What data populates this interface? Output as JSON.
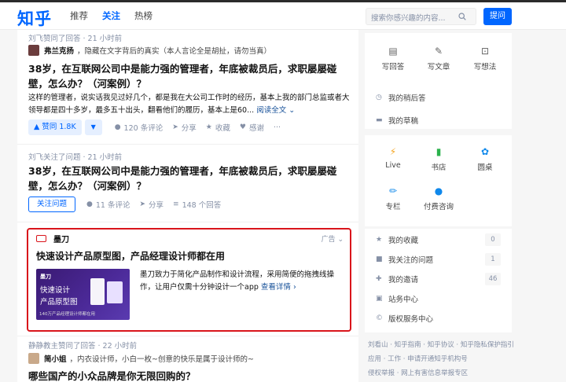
{
  "header": {
    "logo": "知乎",
    "tabs": [
      {
        "label": "推荐",
        "active": false
      },
      {
        "label": "关注",
        "active": true
      },
      {
        "label": "热榜",
        "active": false
      }
    ],
    "search_placeholder": "搜索你感兴趣的内容...",
    "ask_button": "提问"
  },
  "feed": {
    "item1": {
      "meta": "刘飞赞同了回答 · 21 小时前",
      "author": "弗兰克扬",
      "author_bio": "，隐藏在文字背后的真实（本人言论全是胡扯，请勿当真）",
      "title": "38岁，在互联网公司中是能力强的管理者，年底被裁员后，求职屡屡碰壁，怎么办？（河案例）？",
      "excerpt": "这样的管理者，说实话我见过好几个，都是我在大公司工作时的经历，基本上我的部门总监或者大领导都是四十多岁，最多五十出头，翻看他们的履历，基本上是60...",
      "read_more": "阅读全文",
      "vote_up": "▲ 赞同 1.8K",
      "vote_down": "▼",
      "comments": "120 条评论",
      "share": "分享",
      "collect": "收藏",
      "thanks": "感谢",
      "more": "···"
    },
    "item2": {
      "meta": "刘飞关注了问题 · 21 小时前",
      "title": "38岁，在互联网公司中是能力强的管理者，年底被裁员后，求职屡屡碰壁，怎么办？（河案例）？",
      "follow": "关注问题",
      "comments": "11 条评论",
      "share": "分享",
      "answers": "148 个回答"
    },
    "ad": {
      "brand": "墨刀",
      "label": "广告",
      "title": "快速设计产品原型图，产品经理设计师都在用",
      "banner_logo": "墨刀",
      "banner_line1": "快速设计",
      "banner_line2": "产品原型图",
      "banner_line3": "140万产品经理设计师都在用",
      "desc": "墨刀致力于简化产品制作和设计流程，采用简便的拖拽线操作，让用户仅需十分钟设计一个app",
      "read_more": "查看详情"
    },
    "item3": {
      "meta": "静静教主赞同了回答 · 22 小时前",
      "author": "简小姐",
      "author_bio": "，内衣设计师，小白一枚~创意的快乐是属于设计师的~",
      "title": "哪些国产的小众品牌是你无限回购的？"
    }
  },
  "sidebar": {
    "create": [
      {
        "label": "写回答",
        "icon": "answer-icon"
      },
      {
        "label": "写文章",
        "icon": "article-icon"
      },
      {
        "label": "写想法",
        "icon": "idea-icon"
      }
    ],
    "drafts_later": "我的稍后答",
    "drafts": "我的草稿",
    "services": [
      {
        "label": "Live",
        "icon": "live-icon",
        "color": "#f5a623"
      },
      {
        "label": "书店",
        "icon": "bookstore-icon",
        "color": "#2bb24c"
      },
      {
        "label": "圆桌",
        "icon": "roundtable-icon",
        "color": "#0f88eb"
      },
      {
        "label": "专栏",
        "icon": "column-icon",
        "color": "#0f88eb"
      },
      {
        "label": "付费咨询",
        "icon": "consult-icon",
        "color": "#0f88eb"
      }
    ],
    "list": [
      {
        "label": "我的收藏",
        "count": "0",
        "icon": "star-icon"
      },
      {
        "label": "我关注的问题",
        "count": "1",
        "icon": "question-icon"
      },
      {
        "label": "我的邀请",
        "count": "46",
        "icon": "invite-icon"
      },
      {
        "label": "站务中心",
        "count": "",
        "icon": "center-icon"
      },
      {
        "label": "版权服务中心",
        "count": "",
        "icon": "copyright-icon"
      }
    ],
    "footer": [
      "刘看山 · 知乎指南 · 知乎协议 · 知乎隐私保护指引",
      "应用 · 工作 · 申请开通知乎机构号",
      "侵权举报 · 网上有害信息举报专区"
    ]
  }
}
